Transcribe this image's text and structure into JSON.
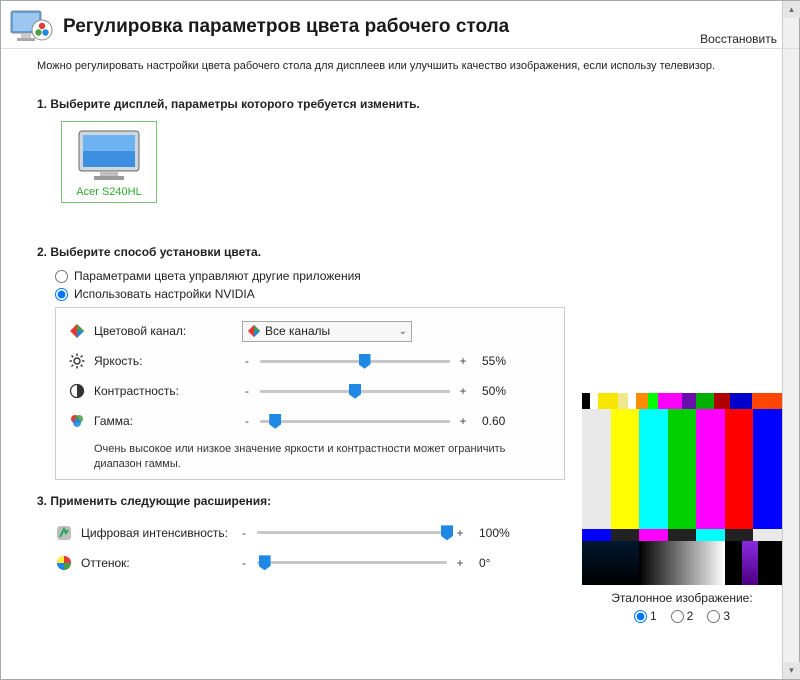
{
  "header": {
    "title": "Регулировка параметров цвета рабочего стола",
    "restore": "Восстановить"
  },
  "intro": "Можно регулировать настройки цвета рабочего стола для дисплеев или улучшить качество изображения, если использу\nтелевизор.",
  "sections": {
    "s1_title": "1. Выберите дисплей, параметры которого требуется изменить.",
    "s2_title": "2. Выберите способ установки цвета.",
    "s3_title": "3. Применить следующие расширения:"
  },
  "display": {
    "name": "Acer S240HL"
  },
  "mode": {
    "option_other_apps": "Параметрами цвета управляют другие приложения",
    "option_nvidia": "Использовать настройки NVIDIA"
  },
  "channel": {
    "label": "Цветовой канал:",
    "selected": "Все каналы"
  },
  "params": {
    "brightness": {
      "label": "Яркость:",
      "value": "55%",
      "pos": 55
    },
    "contrast": {
      "label": "Контрастность:",
      "value": "50%",
      "pos": 50
    },
    "gamma": {
      "label": "Гамма:",
      "value": "0.60",
      "pos": 8
    },
    "hint": "Очень высокое или низкое значение яркости и контрастности может ограничить диапазон гаммы."
  },
  "ext": {
    "vibrance": {
      "label": "Цифровая интенсивность:",
      "value": "100%",
      "pos": 100
    },
    "hue": {
      "label": "Оттенок:",
      "value": "0°",
      "pos": 4
    }
  },
  "reference": {
    "label": "Эталонное изображение:",
    "opts": [
      "1",
      "2",
      "3"
    ]
  }
}
